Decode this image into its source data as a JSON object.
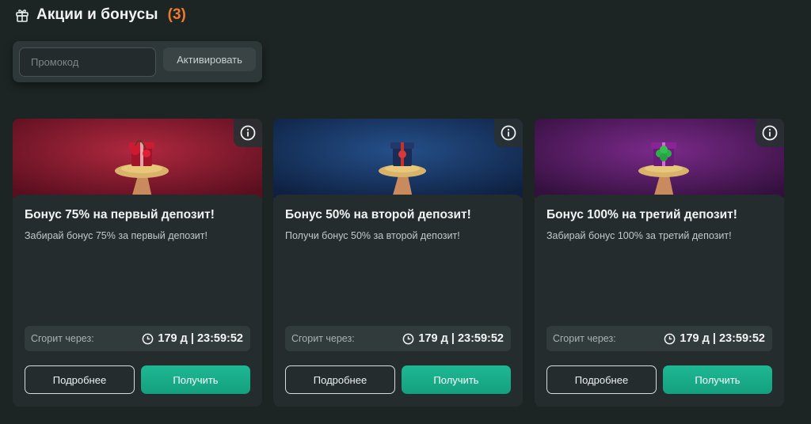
{
  "header": {
    "title": "Акции и бонусы",
    "count": "(3)",
    "icon": "gift-icon",
    "accent_color": "#f07a2c"
  },
  "promo": {
    "placeholder": "Промокод",
    "value": "",
    "activate_label": "Активировать"
  },
  "cards": [
    {
      "title": "Бонус 75% на первый депозит!",
      "description": "Забирай бонус 75% за первый депозит!",
      "expires_label": "Сгорит через:",
      "expires_value": "179 д | 23:59:52",
      "details_label": "Подробнее",
      "get_label": "Получить",
      "banner_color": "#8a1a2e",
      "banner_image": "gift-cherries-on-plate"
    },
    {
      "title": "Бонус 50% на второй депозит!",
      "description": "Получи бонус 50% за второй депозит!",
      "expires_label": "Сгорит через:",
      "expires_value": "179 д | 23:59:52",
      "details_label": "Подробнее",
      "get_label": "Получить",
      "banner_color": "#1a3a6a",
      "banner_image": "gift-box-on-plate"
    },
    {
      "title": "Бонус 100% на третий депозит!",
      "description": "Забирай бонус 100% за третий депозит!",
      "expires_label": "Сгорит через:",
      "expires_value": "179 д | 23:59:52",
      "details_label": "Подробнее",
      "get_label": "Получить",
      "banner_color": "#5a1a6a",
      "banner_image": "gift-clover-on-plate"
    }
  ],
  "colors": {
    "background": "#1c2424",
    "card": "#242c2d",
    "primary_button": "#1fb894"
  }
}
